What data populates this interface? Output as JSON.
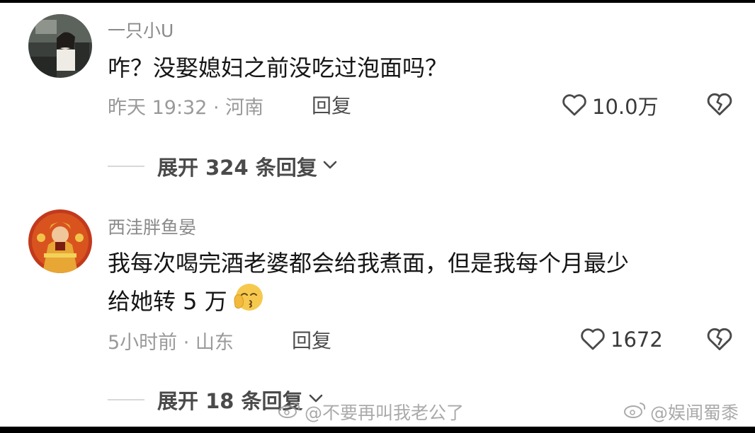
{
  "comments": [
    {
      "username": "一只小U",
      "text": "咋？没娶媳妇之前没吃过泡面吗？",
      "meta": "昨天 19:32 · 河南",
      "reply_label": "回复",
      "likes": "10.0万",
      "expand_label": "展开 324 条回复"
    },
    {
      "username": "西洼胖鱼晏",
      "text_line1": "我每次喝完酒老婆都会给我煮面，但是我每个月最少",
      "text_line2": "给她转 5 万",
      "meta": "5小时前 · 山东",
      "reply_label": "回复",
      "likes": "1672",
      "expand_label": "展开 18 条回复"
    }
  ],
  "watermarks": {
    "left": "@不要再叫我老公了",
    "right": "@娱闻蜀黍"
  },
  "colors": {
    "meta_gray": "#9a9a9a",
    "text": "#151515"
  },
  "icons": [
    "heart-icon",
    "broken-heart-icon",
    "chevron-down-icon",
    "blush-emoji-icon",
    "weibo-icon"
  ]
}
